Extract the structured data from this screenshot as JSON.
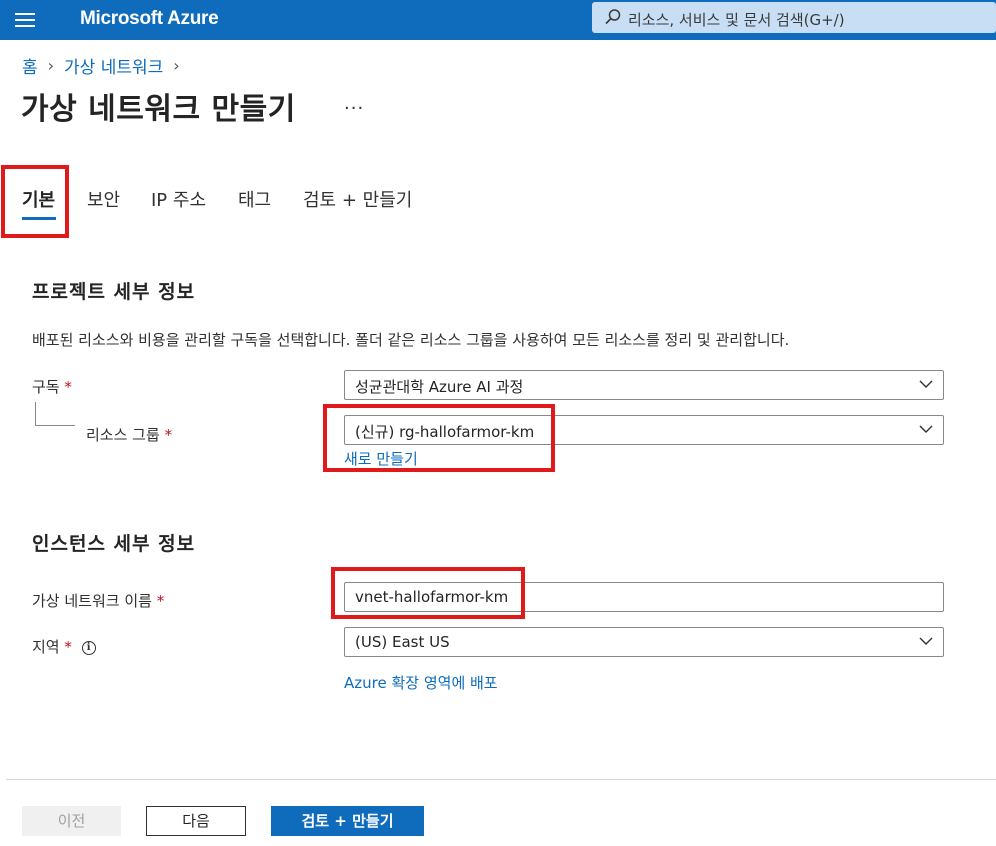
{
  "header": {
    "brand": "Microsoft Azure",
    "search_placeholder": "리소스, 서비스 및 문서 검색(G+/)"
  },
  "breadcrumb": {
    "home": "홈",
    "section": "가상 네트워크"
  },
  "page": {
    "title": "가상 네트워크 만들기",
    "more": "..."
  },
  "tabs": [
    {
      "label": "기본",
      "active": true
    },
    {
      "label": "보안"
    },
    {
      "label": "IP 주소"
    },
    {
      "label": "태그"
    },
    {
      "label": "검토 + 만들기"
    }
  ],
  "project": {
    "title": "프로젝트 세부 정보",
    "description": "배포된 리소스와 비용을 관리할 구독을 선택합니다. 폴더 같은 리소스 그룹을 사용하여 모든 리소스를 정리 및 관리합니다.",
    "subscription_label": "구독",
    "subscription_value": "성균관대학 Azure AI 과정",
    "resource_group_label": "리소스 그룹",
    "resource_group_value": "(신규) rg-hallofarmor-km",
    "create_new_link": "새로 만들기"
  },
  "instance": {
    "title": "인스턴스 세부 정보",
    "vnet_name_label": "가상 네트워크 이름",
    "vnet_name_value": "vnet-hallofarmor-km",
    "region_label": "지역",
    "region_value": "(US) East US",
    "extended_zone_link": "Azure 확장 영역에 배포"
  },
  "required_mark": "*",
  "footer": {
    "prev": "이전",
    "next": "다음",
    "review_create": "검토 + 만들기"
  },
  "colors": {
    "accent": "#0f6cbd",
    "highlight": "#e01a1a",
    "required": "#c50f1f"
  }
}
